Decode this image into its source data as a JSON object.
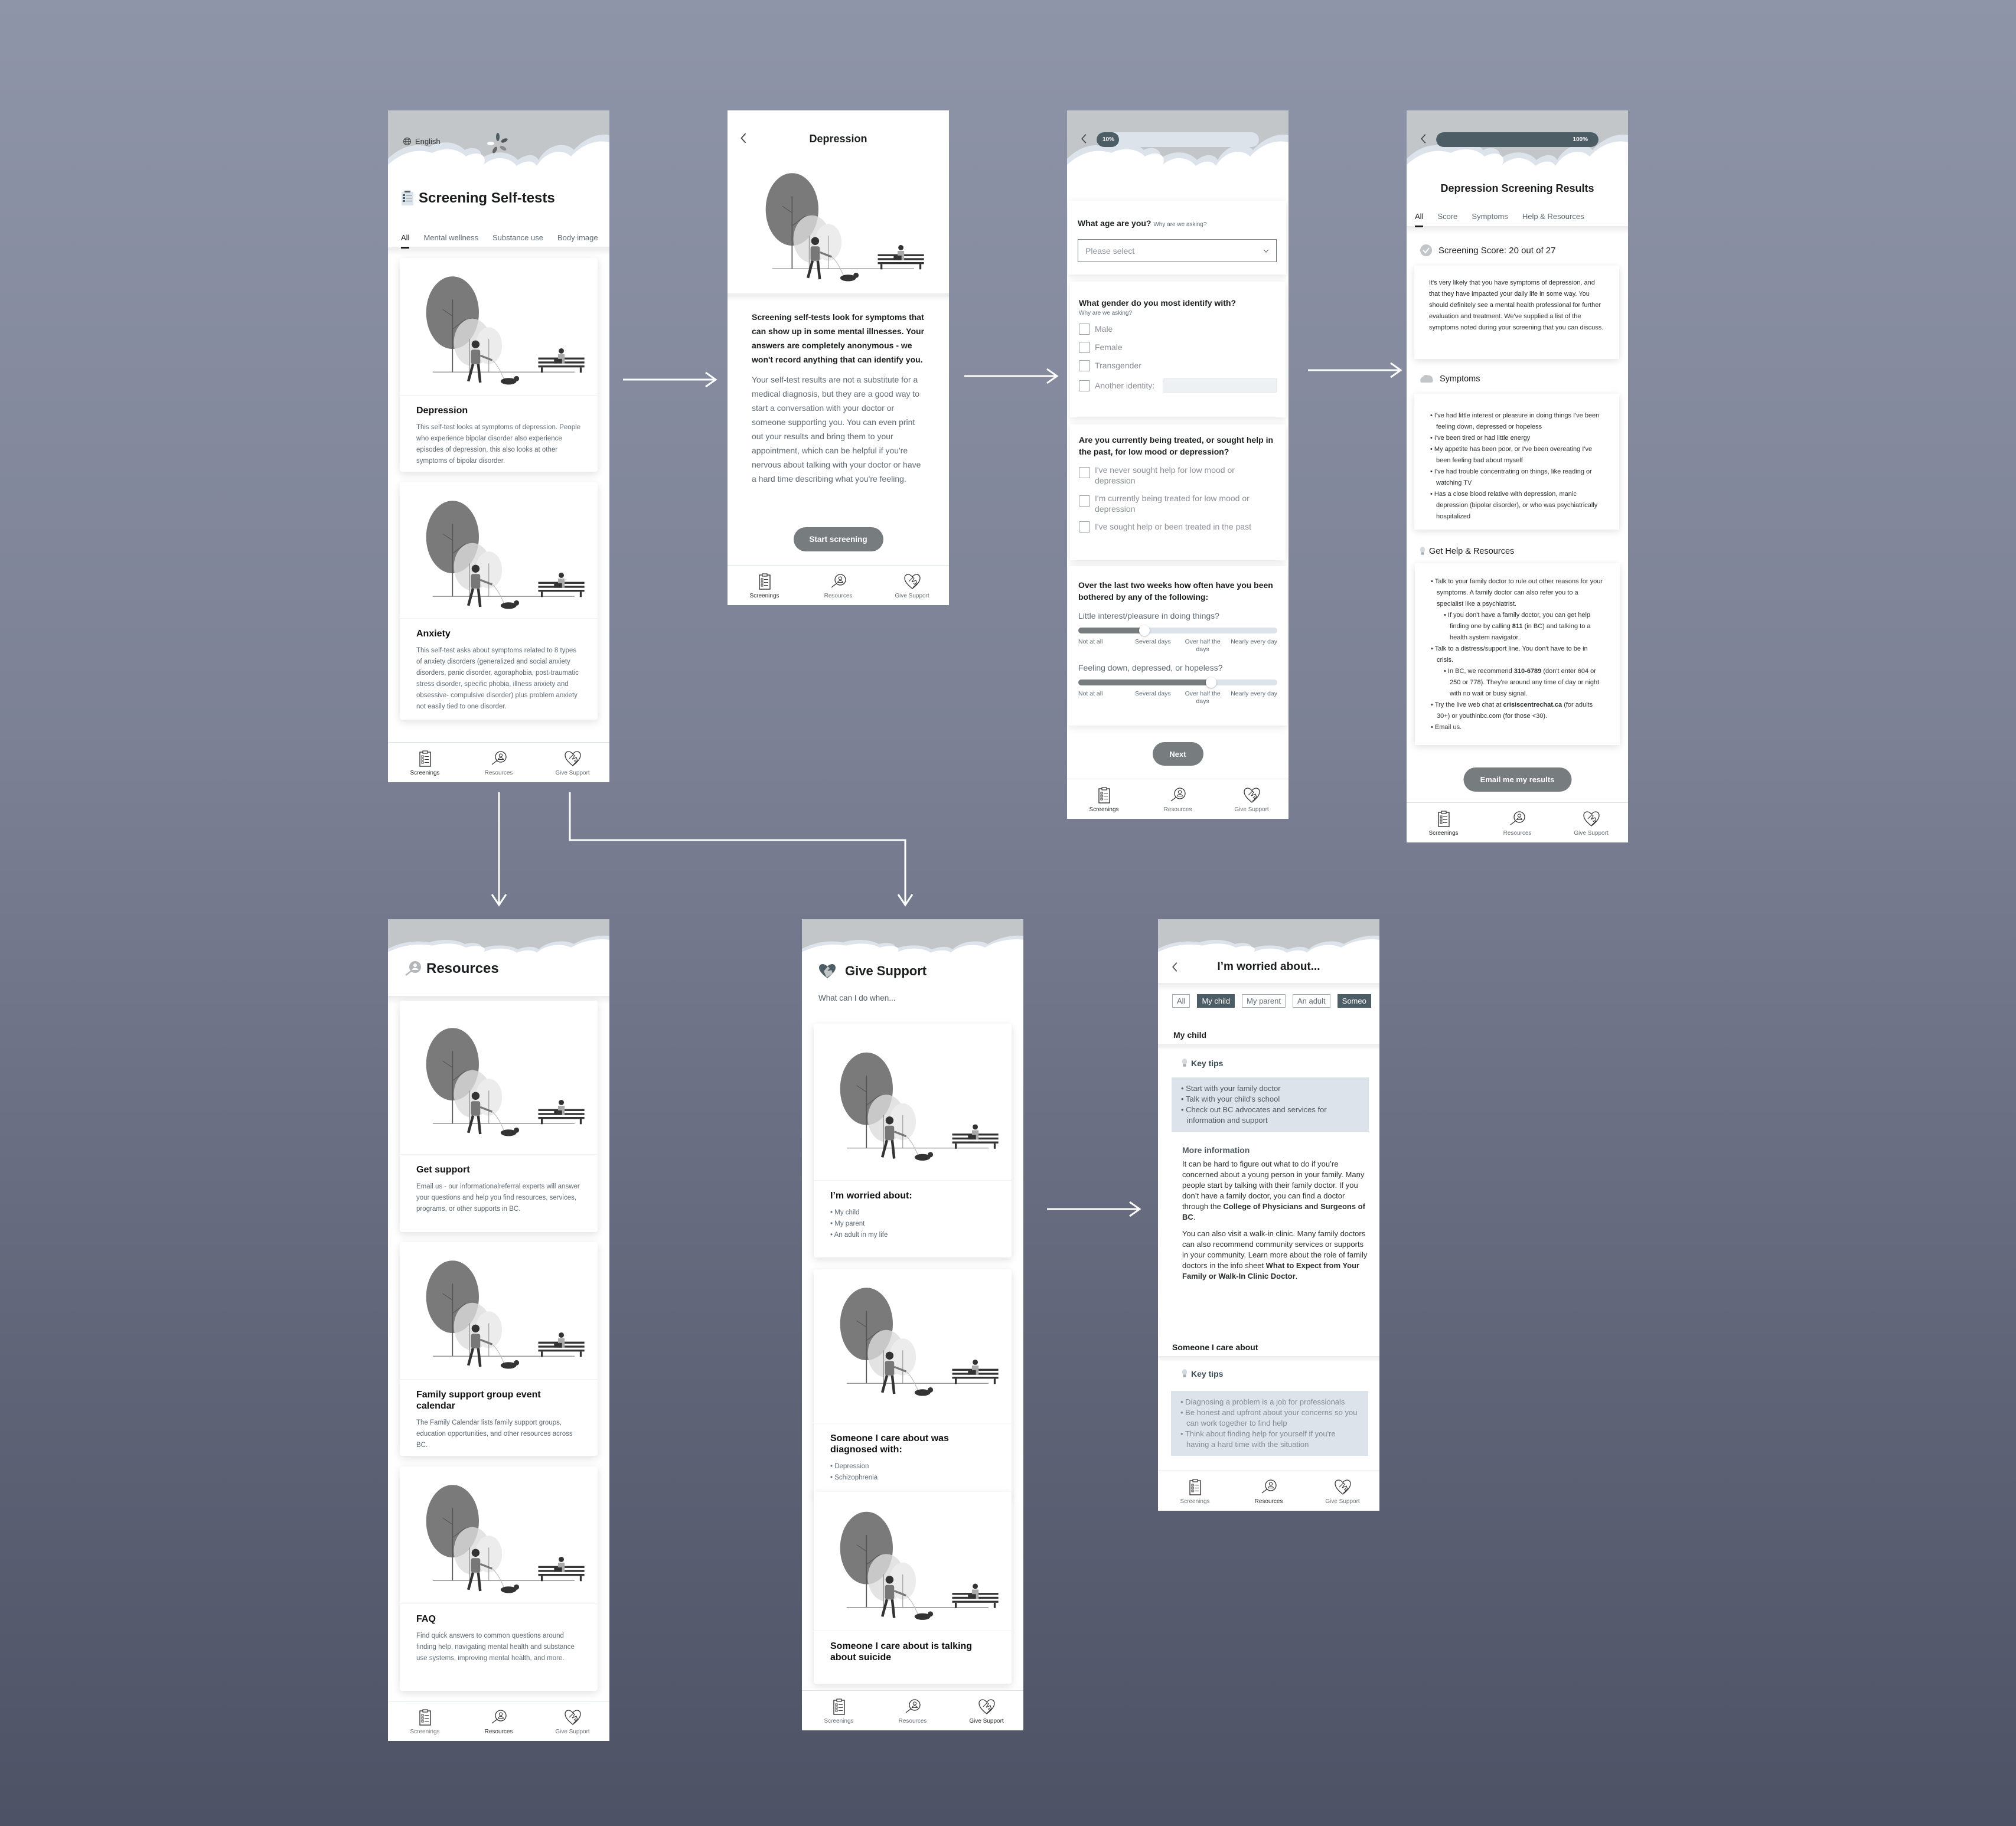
{
  "colors": {
    "background_top": "#8f95a9",
    "background_bottom": "#4d5265",
    "header_gray": "#c3c6c8",
    "accent_dark": "#4d5d65",
    "button_gray": "#777c7f",
    "light_fill": "#dde3ea"
  },
  "nav": {
    "screenings": "Screenings",
    "resources": "Resources",
    "give_support": "Give Support"
  },
  "screen_home": {
    "language": "English",
    "title": "Screening Self-tests",
    "tabs": [
      "All",
      "Mental wellness",
      "Substance use",
      "Body image"
    ],
    "active_tab": "All",
    "cards": [
      {
        "title": "Depression",
        "description": "This self-test looks at symptoms of depression. People who experience bipolar disorder also experience episodes of depression, this also looks at other symptoms of bipolar disorder."
      },
      {
        "title": "Anxiety",
        "description": "This self-test asks about symptoms related to 8 types of anxiety disorders (generalized and social anxiety disorders, panic disorder, agoraphobia, post-traumatic stress disorder, specific phobia, illness anxiety and obsessive- compulsive disorder) plus problem anxiety not easily tied to one disorder."
      }
    ],
    "active_nav": "Screenings"
  },
  "screen_depression_intro": {
    "title": "Depression",
    "intro_bold": "Screening self-tests look for symptoms that can show up in some mental illnesses. Your answers are completely anonymous - we won't record anything that can identify you.",
    "intro_body": "Your self-test results are not a substitute for a medical diagnosis, but they are a good way to start a conversation with your doctor or someone supporting you. You can even print out your results and bring them to your appointment, which can be helpful if you're nervous about talking with your doctor or have a hard time describing what you're feeling.",
    "start_button": "Start screening",
    "active_nav": "Screenings"
  },
  "screen_questionnaire": {
    "progress_label": "10%",
    "progress": 0.1,
    "age_question": "What age are you?",
    "why_asking": "Why are we asking?",
    "age_select_placeholder": "Please select",
    "gender_question": "What gender do you most identify with?",
    "gender_options": [
      "Male",
      "Female",
      "Transgender",
      "Another identity:"
    ],
    "treatment_question": "Are you currently being treated, or sought help in the past, for low mood or depression?",
    "treatment_options": [
      "I've never sought help for low mood or depression",
      "I'm currently being treated for low mood or depression",
      "I've sought help or been treated in the past"
    ],
    "frequency_question": "Over the last two weeks how often have you been bothered by any of the following:",
    "scale_labels": [
      "Not at all",
      "Several days",
      "Over half the days",
      "Nearly every day"
    ],
    "sliders": [
      {
        "label": "Little interest/pleasure in doing things?",
        "value_index": 1,
        "value_label": "Several days"
      },
      {
        "label": "Feeling down, depressed, or hopeless?",
        "value_index": 2,
        "value_label": "Over half the days"
      }
    ],
    "next_button": "Next",
    "active_nav": "Screenings"
  },
  "screen_results": {
    "progress_label": "100%",
    "progress": 1.0,
    "title": "Depression Screening Results",
    "tabs": [
      "All",
      "Score",
      "Symptoms",
      "Help & Resources"
    ],
    "active_tab": "All",
    "score_heading": "Screening Score: 20 out of 27",
    "score_text": "It's very likely that you have symptoms of depression, and that they have impacted your daily life in some way. You should definitely see a mental health professional for further evaluation and treatment. We've supplied a list of the symptoms noted during your screening that you can discuss.",
    "symptoms_heading": "Symptoms",
    "symptoms": [
      "I've had little interest or pleasure in doing things I've been feeling down, depressed or hopeless",
      "I've been tired or had little energy",
      "My appetite has been poor, or I've been overeating I've been feeling bad about myself",
      "I've had trouble concentrating on things, like reading or watching TV",
      "Has a close blood relative with depression, manic depression (bipolar disorder), or who was psychiatrically hospitalized"
    ],
    "help_heading": "Get Help & Resources",
    "help_items": [
      {
        "level": 1,
        "text": "Talk to your family doctor to rule out other reasons for your symptoms. A family doctor can also refer you to a specialist like a psychiatrist."
      },
      {
        "level": 2,
        "pre": "If you don't have a family doctor, you can get help finding one by calling ",
        "bold": "811",
        "post": " (in BC) and talking to a health system navigator."
      },
      {
        "level": 1,
        "text": "Talk to a distress/support line. You don't have to be in crisis."
      },
      {
        "level": 2,
        "pre": "In BC, we recommend ",
        "bold": "310-6789",
        "post": " (don't enter 604 or 250 or 778). They're around any time of day or night with no wait or busy signal."
      },
      {
        "level": 1,
        "pre": "Try the live web chat at ",
        "bold": "crisiscentrechat.ca",
        "post": " (for adults 30+) or  youthinbc.com (for those <30)."
      },
      {
        "level": 1,
        "text": "Email us."
      }
    ],
    "email_button": "Email me my results",
    "active_nav": "Screenings"
  },
  "screen_resources": {
    "title": "Resources",
    "cards": [
      {
        "title": "Get support",
        "description": "Email us - our informationalreferral experts will answer your questions and help you find resources, services, programs, or other supports in BC."
      },
      {
        "title": "Family support group event calendar",
        "description": "The Family Calendar lists family support groups, education opportunities, and other resources across BC."
      },
      {
        "title": "FAQ",
        "description": "Find quick answers to common questions around finding help, navigating mental health and substance use systems, improving mental health, and more."
      }
    ],
    "active_nav": "Resources"
  },
  "screen_give_support": {
    "title": "Give Support",
    "subtitle": "What can I do when...",
    "cards": [
      {
        "title": "I’m worried about:",
        "items": [
          "My child",
          "My parent",
          "An adult in my life"
        ]
      },
      {
        "title": "Someone I care about was diagnosed with:",
        "items": [
          "Depression",
          "Schizophrenia"
        ]
      },
      {
        "title": "Someone I care about is talking about suicide",
        "items": []
      }
    ],
    "active_nav": "Give Support"
  },
  "screen_worried": {
    "title": "I’m worried about...",
    "chips": [
      "All",
      "My child",
      "My parent",
      "An adult",
      "Someo"
    ],
    "active_chips": [
      "My child",
      "Someo"
    ],
    "section1_title": "My child",
    "key_tips_label": "Key tips",
    "section1_tips": [
      "Start with your family doctor",
      "Talk with your child's school",
      "Check out BC advocates and services for information and support"
    ],
    "more_info_label": "More information",
    "more_info_p1_pre": "It can be hard to figure out what to do if you’re concerned about a young person in your family. Many people start by talking with their family doctor. If you don’t have a family doctor, you can find a doctor through the ",
    "more_info_p1_bold": "College of Physicians and Surgeons of BC",
    "more_info_p1_post": ".",
    "more_info_p2_pre": "You can also visit a walk-in clinic. Many family doctors can also recommend community services or supports in your community. Learn more about the role of family doctors in the info sheet ",
    "more_info_p2_bold": "What to Expect from Your Family or Walk-In Clinic Doctor",
    "more_info_p2_post": ".",
    "section2_title": "Someone I care about",
    "section2_tips": [
      "Diagnosing a problem is a job for professionals",
      "Be honest and upfront about your concerns so you can work together to find help",
      "Think about finding help for yourself if you're having a hard time with the situation"
    ],
    "active_nav": "Resources"
  }
}
